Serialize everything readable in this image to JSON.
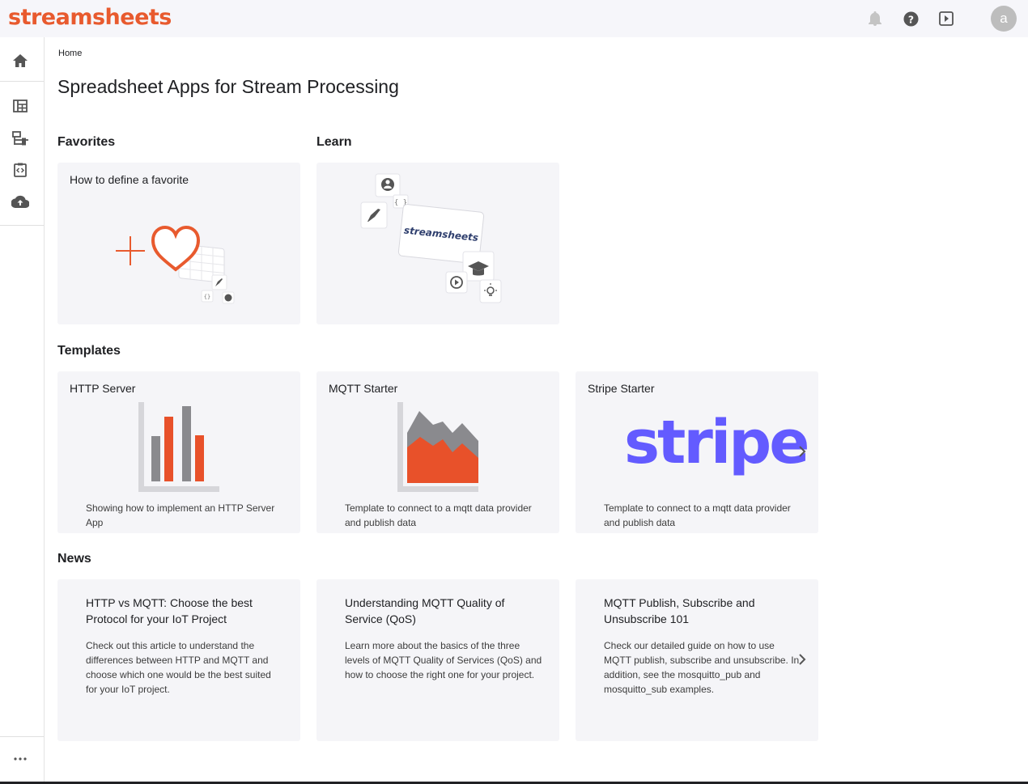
{
  "app": {
    "logo": "streamsheets"
  },
  "header": {
    "avatar_letter": "a"
  },
  "breadcrumb": "Home",
  "page_title": "Spreadsheet Apps for Stream Processing",
  "sections": {
    "favorites": "Favorites",
    "learn": "Learn",
    "templates": "Templates",
    "news": "News"
  },
  "favorites_card": {
    "title": "How to define a favorite"
  },
  "learn_card": {
    "logo_text": "streamsheets"
  },
  "templates": [
    {
      "title": "HTTP Server",
      "desc": "Showing how to implement an HTTP Server App"
    },
    {
      "title": "MQTT Starter",
      "desc": "Template to connect to a mqtt data provider and publish data"
    },
    {
      "title": "Stripe Starter",
      "logo": "stripe",
      "desc": "Template to connect to a mqtt data provider and publish data"
    }
  ],
  "news": [
    {
      "title": "HTTP vs MQTT: Choose the best Protocol for your IoT Project",
      "desc": "Check out this article to understand the differences between HTTP and MQTT and choose which one would be the best suited for your IoT project."
    },
    {
      "title": "Understanding MQTT Quality of Service (QoS)",
      "desc": "Learn more about the basics of the three levels of MQTT Quality of Services (QoS) and how to choose the right one for your project."
    },
    {
      "title": "MQTT Publish, Subscribe and Unsubscribe 101",
      "desc": "Check our detailed guide on how to use MQTT publish, subscribe and unsubscribe. In addition, see the mosquitto_pub and mosquitto_sub examples."
    }
  ],
  "colors": {
    "brand": "#e85a2e",
    "stripe": "#635bff",
    "card_bg": "#f5f5f8",
    "chart_gray": "#8a8a8e"
  },
  "icons": {
    "top": [
      "bell-icon",
      "help-icon",
      "play-icon"
    ],
    "rail": [
      "home-icon",
      "dashboard-icon",
      "tree-icon",
      "export-icon",
      "cloud-upload-icon",
      "more-icon"
    ]
  }
}
